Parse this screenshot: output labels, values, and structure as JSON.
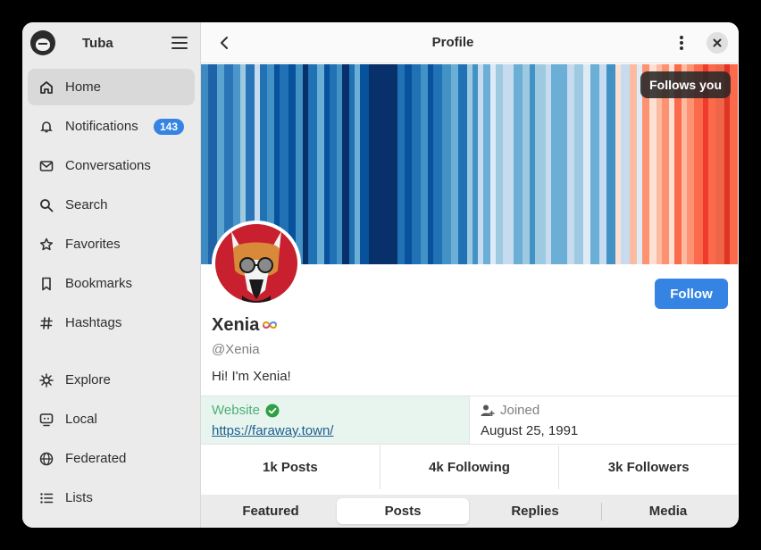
{
  "sidebar": {
    "app_title": "Tuba",
    "items": [
      {
        "label": "Home",
        "icon": "home-icon"
      },
      {
        "label": "Notifications",
        "icon": "bell-icon",
        "badge": "143"
      },
      {
        "label": "Conversations",
        "icon": "mail-icon"
      },
      {
        "label": "Search",
        "icon": "search-icon"
      },
      {
        "label": "Favorites",
        "icon": "star-icon"
      },
      {
        "label": "Bookmarks",
        "icon": "bookmark-icon"
      },
      {
        "label": "Hashtags",
        "icon": "hash-icon"
      },
      {
        "label": "Explore",
        "icon": "explore-icon"
      },
      {
        "label": "Local",
        "icon": "local-icon"
      },
      {
        "label": "Federated",
        "icon": "globe-icon"
      },
      {
        "label": "Lists",
        "icon": "list-icon"
      }
    ]
  },
  "header": {
    "title": "Profile"
  },
  "profile": {
    "follows_you": "Follows you",
    "follow_label": "Follow",
    "display_name": "Xenia",
    "handle": "@Xenia",
    "bio": "Hi! I'm Xenia!",
    "fields": {
      "website_key": "Website",
      "website_value": "https://faraway.town/",
      "joined_key": "Joined",
      "joined_value": "August 25, 1991"
    },
    "stats": {
      "posts": "1k Posts",
      "following": "4k Following",
      "followers": "3k Followers"
    }
  },
  "tabs": [
    "Featured",
    "Posts",
    "Replies",
    "Media"
  ],
  "colors": {
    "accent": "#3584e4",
    "verified": "#2ea043"
  }
}
